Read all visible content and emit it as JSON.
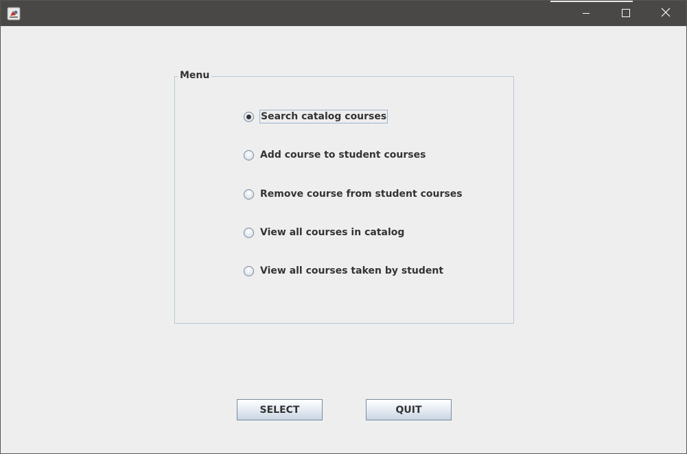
{
  "window": {
    "icon": "java-app-icon",
    "controls": {
      "minimize": "minimize-icon",
      "maximize": "maximize-icon",
      "close": "close-icon"
    }
  },
  "menu": {
    "title": "Menu",
    "selected_index": 0,
    "options": [
      {
        "label": "Search catalog courses",
        "selected": true
      },
      {
        "label": "Add course to student courses",
        "selected": false
      },
      {
        "label": "Remove course from student courses",
        "selected": false
      },
      {
        "label": "View all courses in catalog",
        "selected": false
      },
      {
        "label": "View all courses taken by student",
        "selected": false
      }
    ]
  },
  "buttons": {
    "select_label": "SELECT",
    "quit_label": "QUIT"
  },
  "colors": {
    "titlebar": "#4a4846",
    "background": "#eeeeee",
    "group_border": "#b6c8d8",
    "text": "#333333"
  }
}
